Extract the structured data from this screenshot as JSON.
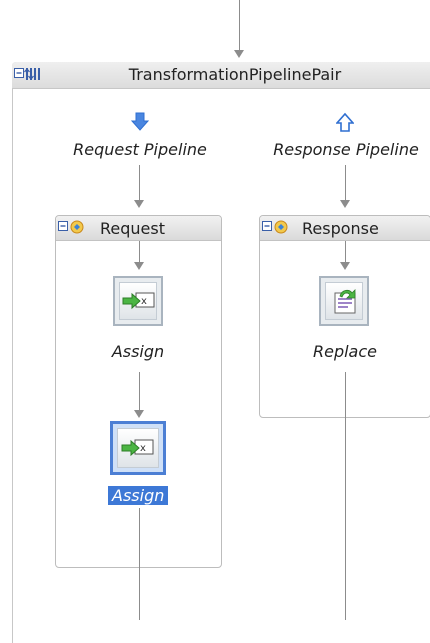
{
  "pipeline_pair": {
    "title": "TransformationPipelinePair",
    "request_pipeline_label": "Request Pipeline",
    "response_pipeline_label": "Response Pipeline"
  },
  "request_stage": {
    "title": "Request",
    "actions": [
      {
        "label": "Assign",
        "icon": "assign-icon",
        "selected": false
      },
      {
        "label": "Assign",
        "icon": "assign-icon",
        "selected": true
      }
    ]
  },
  "response_stage": {
    "title": "Response",
    "actions": [
      {
        "label": "Replace",
        "icon": "replace-icon",
        "selected": false
      }
    ]
  },
  "colors": {
    "selection": "#3d78d6",
    "connector": "#8c8c8c",
    "header_bg": "#dcdcdc",
    "request_arrow": "#2f6fd1",
    "response_arrow": "#2f6fd1"
  }
}
